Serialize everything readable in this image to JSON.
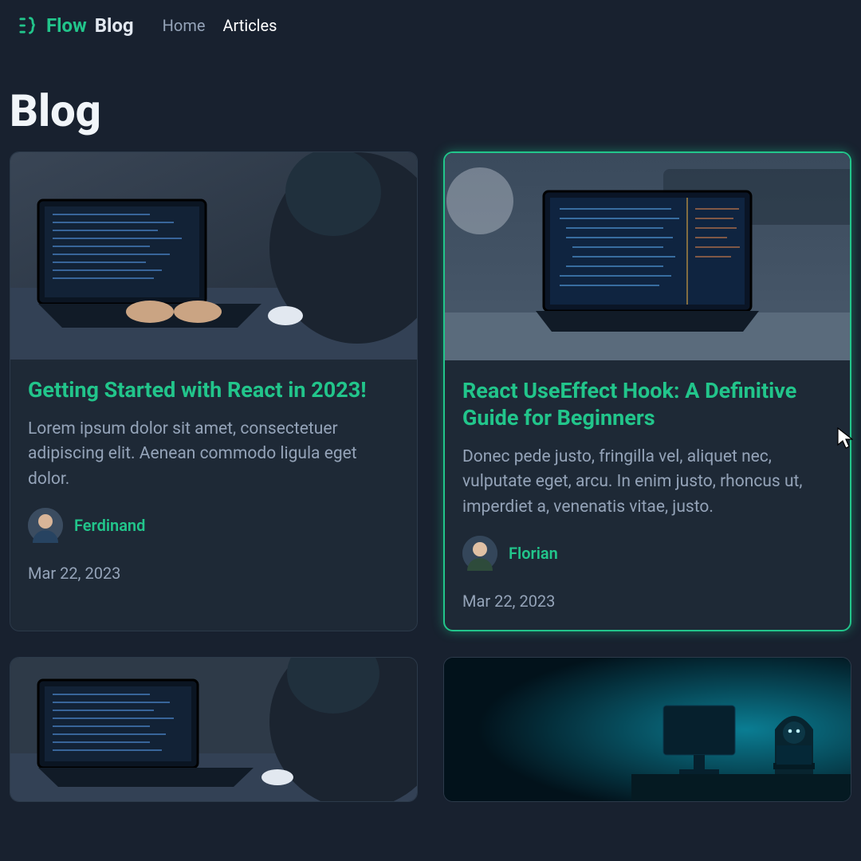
{
  "brand": {
    "accent": "Flow",
    "plain": "Blog"
  },
  "nav": {
    "home": "Home",
    "articles": "Articles"
  },
  "page_title": "Blog",
  "cards": [
    {
      "title": "Getting Started with React in 2023!",
      "excerpt": "Lorem ipsum dolor sit amet, consectetuer adipiscing elit. Aenean commodo ligula eget dolor.",
      "author": "Ferdinand",
      "date": "Mar 22, 2023",
      "highlight": false
    },
    {
      "title": "React UseEffect Hook: A Definitive Guide for Beginners",
      "excerpt": "Donec pede justo, fringilla vel, aliquet nec, vulputate eget, arcu. In enim justo, rhoncus ut, imperdiet a, venenatis vitae, justo.",
      "author": "Florian",
      "date": "Mar 22, 2023",
      "highlight": true
    }
  ],
  "colors": {
    "accent": "#22c58b",
    "bg": "#18212f",
    "card": "#1e2936"
  }
}
